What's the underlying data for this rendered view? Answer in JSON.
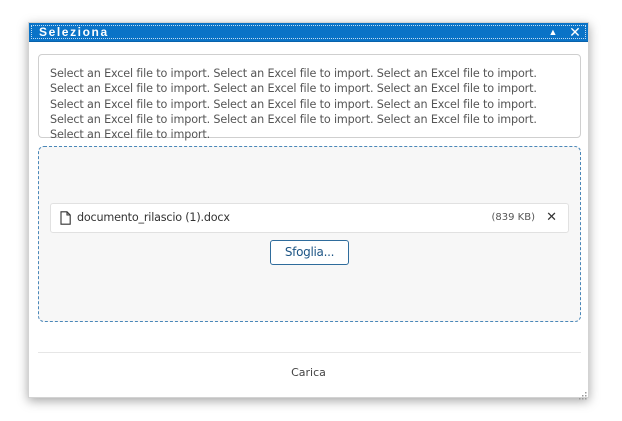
{
  "dialog": {
    "title": "Seleziona",
    "collapse_icon": "▲",
    "close_icon": "✕"
  },
  "description": "Select an Excel file to import. Select an Excel file to import. Select an Excel file to import. Select an Excel file to import. Select an Excel file to import. Select an Excel file to import. Select an Excel file to import. Select an Excel file to import. Select an Excel file to import. Select an Excel file to import. Select an Excel file to import. Select an Excel file to import. Select an Excel file to import.",
  "file": {
    "name": "documento_rilascio (1).docx",
    "size": "(839 KB)",
    "remove_icon": "✕"
  },
  "browse_label": "Sfoglia...",
  "upload_label": "Carica",
  "colors": {
    "titlebar": "#0a73c7",
    "dropzone_border": "#4a87b8",
    "button_border": "#2f6c9c"
  }
}
